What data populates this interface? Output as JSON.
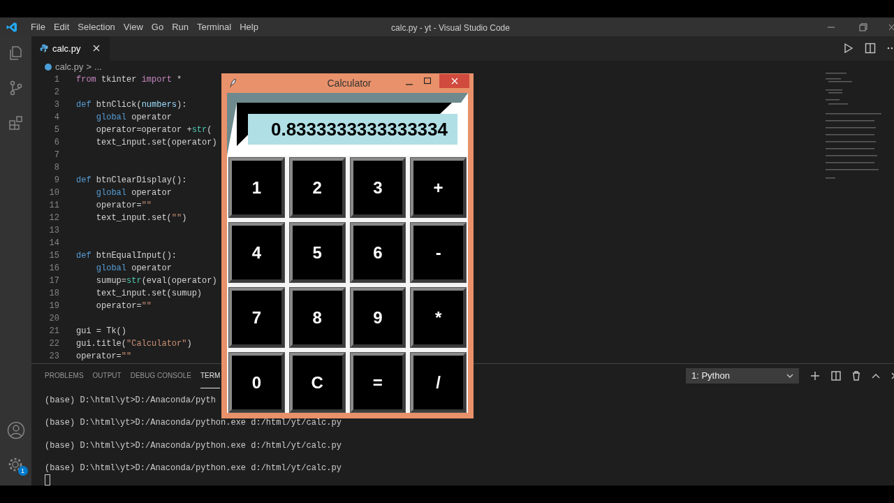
{
  "title_bar": {
    "menu": [
      "File",
      "Edit",
      "Selection",
      "View",
      "Go",
      "Run",
      "Terminal",
      "Help"
    ],
    "title": "calc.py - yt - Visual Studio Code"
  },
  "activity_bar": {
    "settings_badge": "1"
  },
  "editor": {
    "tabs": [
      {
        "label": "calc.py",
        "selected": true
      }
    ],
    "breadcrumb": [
      "calc.py",
      ">",
      "..."
    ],
    "lines": [
      {
        "n": "1",
        "tokens": [
          {
            "t": "from",
            "kind": "keyword"
          },
          {
            "t": " tkinter ",
            "kind": "plain"
          },
          {
            "t": "import",
            "kind": "keyword"
          },
          {
            "t": " *",
            "kind": "plain"
          }
        ]
      },
      {
        "n": "2"
      },
      {
        "n": "3",
        "tokens": [
          {
            "t": "def",
            "kind": "storage"
          },
          {
            "t": " btnClick(",
            "kind": "plain"
          },
          {
            "t": "numbers",
            "kind": "param"
          },
          {
            "t": "):",
            "kind": "plain"
          }
        ]
      },
      {
        "n": "4",
        "tokens": [
          {
            "t": "    global",
            "kind": "storage"
          },
          {
            "t": " operator",
            "kind": "plain"
          }
        ]
      },
      {
        "n": "5",
        "tokens": [
          {
            "t": "    operator=operator +",
            "kind": "plain"
          },
          {
            "t": "str",
            "kind": "builtin"
          },
          {
            "t": "(",
            "kind": "plain"
          }
        ]
      },
      {
        "n": "6",
        "tokens": [
          {
            "t": "    text_input.set(operator)",
            "kind": "plain"
          }
        ]
      },
      {
        "n": "7"
      },
      {
        "n": "8"
      },
      {
        "n": "9",
        "tokens": [
          {
            "t": "def",
            "kind": "storage"
          },
          {
            "t": " btnClearDisplay():",
            "kind": "plain"
          }
        ]
      },
      {
        "n": "10",
        "tokens": [
          {
            "t": "    global",
            "kind": "storage"
          },
          {
            "t": " operator",
            "kind": "plain"
          }
        ]
      },
      {
        "n": "11",
        "tokens": [
          {
            "t": "    operator=",
            "kind": "plain"
          },
          {
            "t": "\"\"",
            "kind": "string"
          }
        ]
      },
      {
        "n": "12",
        "tokens": [
          {
            "t": "    text_input.set(",
            "kind": "plain"
          },
          {
            "t": "\"\"",
            "kind": "string"
          },
          {
            "t": ")",
            "kind": "plain"
          }
        ]
      },
      {
        "n": "13"
      },
      {
        "n": "14"
      },
      {
        "n": "15",
        "tokens": [
          {
            "t": "def",
            "kind": "storage"
          },
          {
            "t": " btnEqualInput():",
            "kind": "plain"
          }
        ]
      },
      {
        "n": "16",
        "tokens": [
          {
            "t": "    global",
            "kind": "storage"
          },
          {
            "t": " operator",
            "kind": "plain"
          }
        ]
      },
      {
        "n": "17",
        "tokens": [
          {
            "t": "    sumup=",
            "kind": "plain"
          },
          {
            "t": "str",
            "kind": "builtin"
          },
          {
            "t": "(eval(operator)",
            "kind": "plain"
          }
        ]
      },
      {
        "n": "18",
        "tokens": [
          {
            "t": "    text_input.set(sumup)",
            "kind": "plain"
          }
        ]
      },
      {
        "n": "19",
        "tokens": [
          {
            "t": "    operator=",
            "kind": "plain"
          },
          {
            "t": "\"\"",
            "kind": "string"
          }
        ]
      },
      {
        "n": "20"
      },
      {
        "n": "21",
        "tokens": [
          {
            "t": "gui = Tk()",
            "kind": "plain"
          }
        ]
      },
      {
        "n": "22",
        "tokens": [
          {
            "t": "gui.title(",
            "kind": "plain"
          },
          {
            "t": "\"Calculator\"",
            "kind": "string"
          },
          {
            "t": ")",
            "kind": "plain"
          }
        ]
      },
      {
        "n": "23",
        "tokens": [
          {
            "t": "operator=",
            "kind": "plain"
          },
          {
            "t": "\"\"",
            "kind": "string"
          }
        ]
      }
    ]
  },
  "panel": {
    "tabs": [
      {
        "label": "PROBLEMS",
        "selected": false
      },
      {
        "label": "OUTPUT",
        "selected": false
      },
      {
        "label": "DEBUG CONSOLE",
        "selected": false
      },
      {
        "label": "TERM",
        "selected": true
      }
    ],
    "terminal_select": "1: Python",
    "terminal_lines": [
      "(base) D:\\html\\yt>D:/Anaconda/pyth",
      "(base) D:\\html\\yt>D:/Anaconda/python.exe d:/html/yt/calc.py",
      "(base) D:\\html\\yt>D:/Anaconda/python.exe d:/html/yt/calc.py",
      "(base) D:\\html\\yt>D:/Anaconda/python.exe d:/html/yt/calc.py"
    ]
  },
  "calculator": {
    "title": "Calculator",
    "display": "0.8333333333333334",
    "keys": [
      "1",
      "2",
      "3",
      "+",
      "4",
      "5",
      "6",
      "-",
      "7",
      "8",
      "9",
      "*",
      "0",
      "C",
      "=",
      "/"
    ]
  }
}
